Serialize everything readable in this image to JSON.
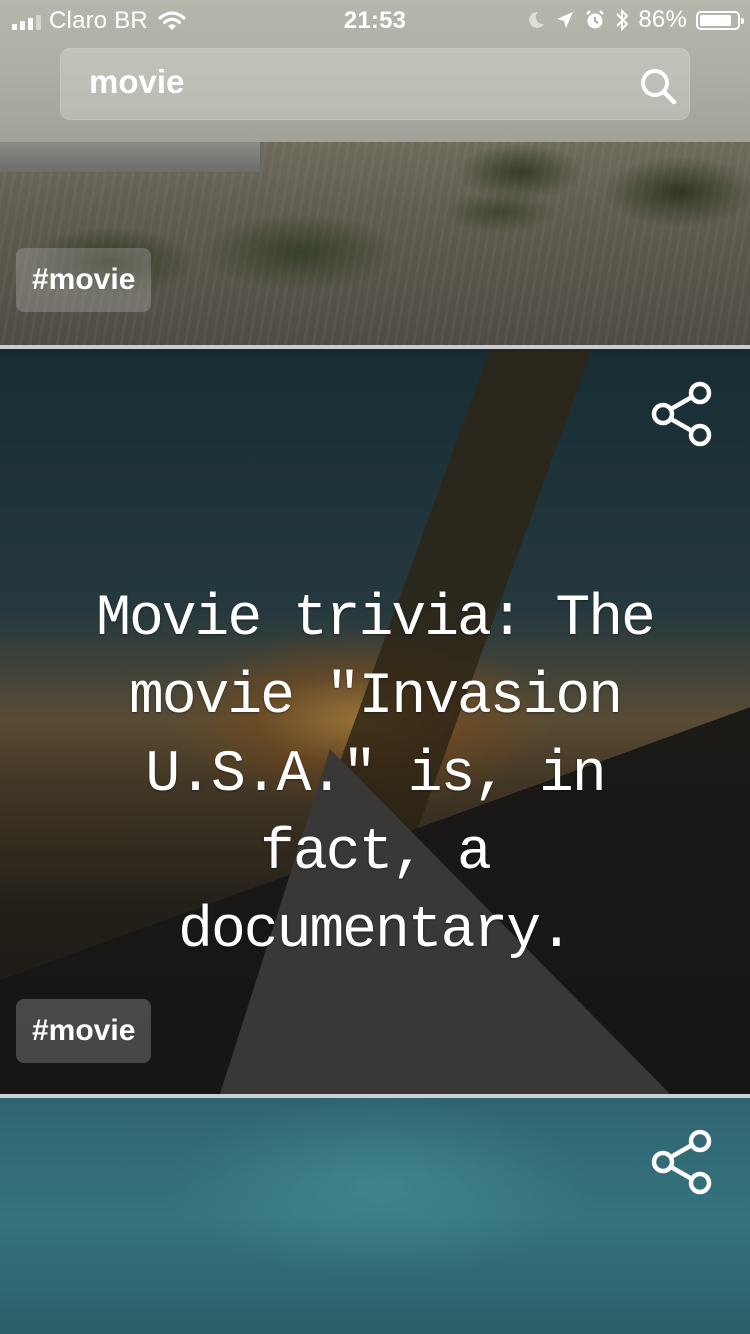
{
  "status_bar": {
    "carrier": "Claro BR",
    "time": "21:53",
    "battery_percent": "86%",
    "battery_level": 0.86,
    "icons": [
      "signal-icon",
      "wifi-icon",
      "moon-icon",
      "location-icon",
      "alarm-icon",
      "bluetooth-icon",
      "battery-icon"
    ]
  },
  "search": {
    "value": "movie",
    "icon": "search-icon"
  },
  "cards": [
    {
      "tag": "#movie"
    },
    {
      "text": "Movie trivia: The movie \"Invasion U.S.A.\" is, in fact, a documentary.",
      "tag": "#movie",
      "icon": "share-icon"
    },
    {
      "icon": "share-icon"
    }
  ]
}
